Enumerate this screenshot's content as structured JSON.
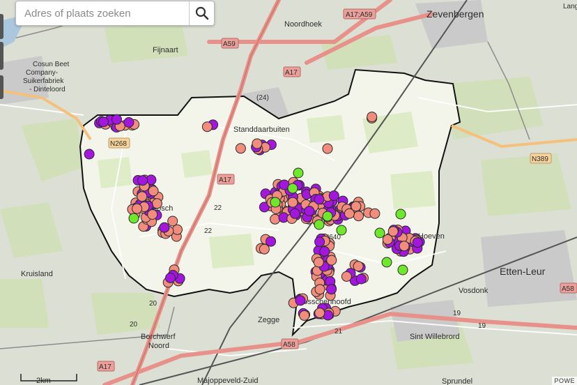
{
  "search": {
    "placeholder": "Adres of plaats zoeken",
    "icon": "search-icon"
  },
  "places": {
    "zevenbergen": "Zevenbergen",
    "noordhoek": "Noordhoek",
    "fijnaart": "Fijnaart",
    "cosun": [
      "Cosun Beet",
      "Company-",
      "Suikerfabriek",
      "- Dinteloord"
    ],
    "standdaarbuiten": "Standdaarbuiten",
    "oudenbosch": "Oudenbosch",
    "hoeven": "Hoeven",
    "bosschenhoofd": "Bosschenhoofd",
    "kruisland": "Kruisland",
    "zegge": "Zegge",
    "borchwerf": [
      "Borchwerf",
      "Noord"
    ],
    "etten_leur": "Etten-Leur",
    "vosdonk": "Vosdonk",
    "sint_willebrord": "Sint Willebrord",
    "majoppeveld": "Majoppeveld-Zuid",
    "sprundel": "Sprundel",
    "langeweg": "Lang"
  },
  "roads": {
    "a17_a59": "A17;A59",
    "a59": "A59",
    "a17_north": "A17",
    "a17_mid": "A17",
    "a17_south": "A17",
    "a58_left": "A58",
    "a58_right": "A58",
    "n268": "N268",
    "n389": "N389",
    "n640": "N640",
    "r24": "(24)",
    "r22a": "22",
    "r22b": "22",
    "r20a": "20",
    "r20b": "20",
    "r21": "21",
    "r19a": "19",
    "r19b": "19"
  },
  "scale_bar": "2km",
  "attribution": "POWE",
  "colors": {
    "municipality_fill": "#f3f4ea",
    "salmon_marker": "#f28c7c",
    "purple_marker": "#a316e0",
    "green_marker": "#6ee82a",
    "highway": "#e8908a"
  }
}
